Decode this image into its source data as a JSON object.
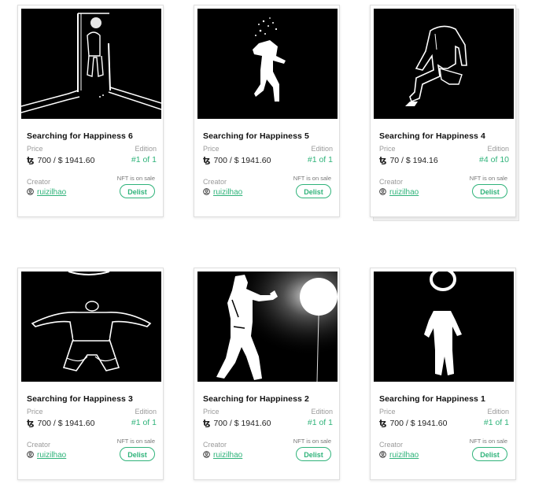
{
  "cards": [
    {
      "title": "Searching for Happiness 6",
      "price_label": "Price",
      "currency_symbol": "ꜩ",
      "price": "700 / $ 1941.60",
      "edition_label": "Edition",
      "edition": "#1 of 1",
      "creator_label": "Creator",
      "creator": "ruizilhao",
      "sale_status": "NFT is on sale",
      "action_label": "Delist"
    },
    {
      "title": "Searching for Happiness 5",
      "price_label": "Price",
      "currency_symbol": "ꜩ",
      "price": "700 / $ 1941.60",
      "edition_label": "Edition",
      "edition": "#1 of 1",
      "creator_label": "Creator",
      "creator": "ruizilhao",
      "sale_status": "NFT is on sale",
      "action_label": "Delist"
    },
    {
      "title": "Searching for Happiness 4",
      "price_label": "Price",
      "currency_symbol": "ꜩ",
      "price": "70 / $ 194.16",
      "edition_label": "Edition",
      "edition": "#4 of 10",
      "creator_label": "Creator",
      "creator": "ruizilhao",
      "sale_status": "NFT is on sale",
      "action_label": "Delist"
    },
    {
      "title": "Searching for Happiness 3",
      "price_label": "Price",
      "currency_symbol": "ꜩ",
      "price": "700 / $ 1941.60",
      "edition_label": "Edition",
      "edition": "#1 of 1",
      "creator_label": "Creator",
      "creator": "ruizilhao",
      "sale_status": "NFT is on sale",
      "action_label": "Delist"
    },
    {
      "title": "Searching for Happiness 2",
      "price_label": "Price",
      "currency_symbol": "ꜩ",
      "price": "700 / $ 1941.60",
      "edition_label": "Edition",
      "edition": "#1 of 1",
      "creator_label": "Creator",
      "creator": "ruizilhao",
      "sale_status": "NFT is on sale",
      "action_label": "Delist"
    },
    {
      "title": "Searching for Happiness 1",
      "price_label": "Price",
      "currency_symbol": "ꜩ",
      "price": "700 / $ 1941.60",
      "edition_label": "Edition",
      "edition": "#1 of 1",
      "creator_label": "Creator",
      "creator": "ruizilhao",
      "sale_status": "NFT is on sale",
      "action_label": "Delist"
    }
  ],
  "colors": {
    "accent": "#2fb37a",
    "label": "#9a9a9a",
    "artwork_background": "#000000"
  },
  "icons": [
    "tezos-icon",
    "user-circle-icon"
  ]
}
